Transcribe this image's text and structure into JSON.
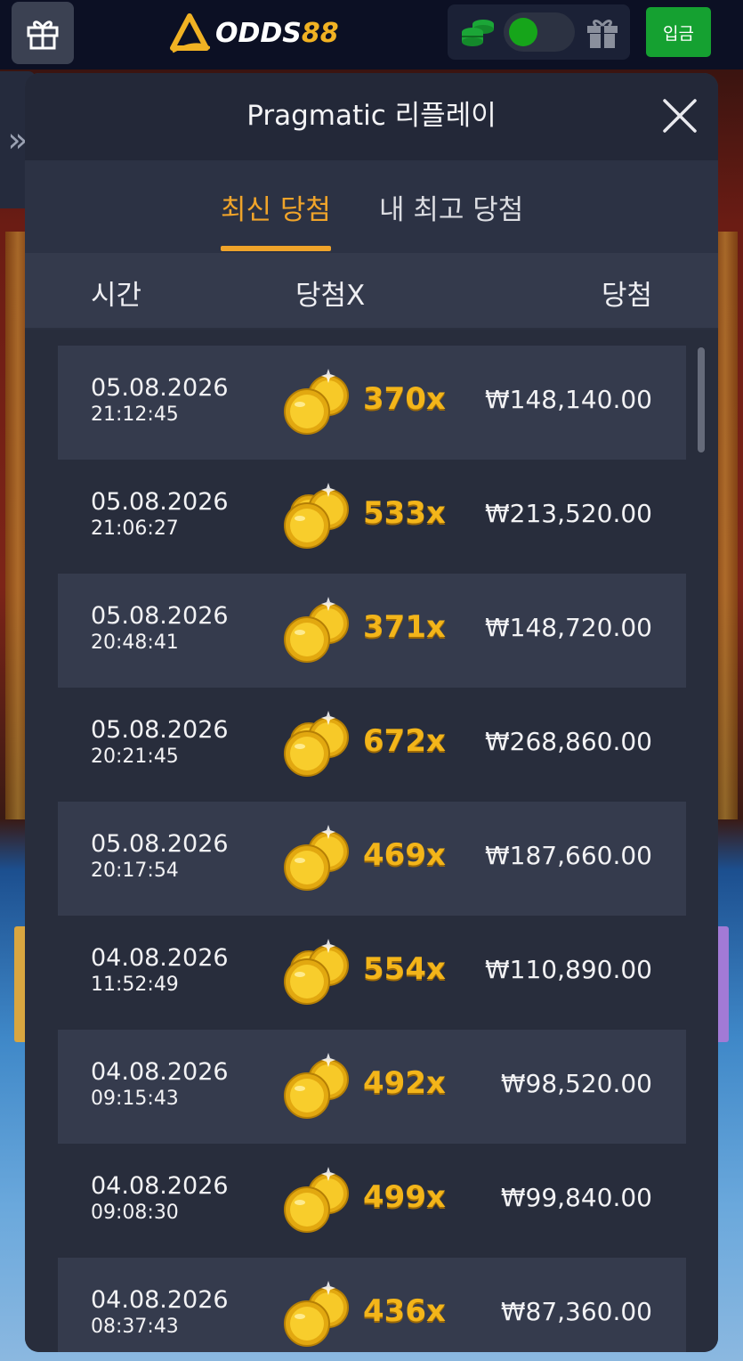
{
  "topbar": {
    "brand": "ODDS",
    "brand_number": "88",
    "deposit_label": "입금",
    "toggle_on": true
  },
  "side_tab": {
    "glyph": "»"
  },
  "modal": {
    "title": "Pragmatic 리플레이",
    "tabs": [
      {
        "label": "최신 당첨",
        "active": true
      },
      {
        "label": "내 최고 당첨",
        "active": false
      }
    ],
    "columns": {
      "time": "시간",
      "multiplier": "당첨X",
      "win": "당첨"
    },
    "rows": [
      {
        "date": "05.08.2026",
        "time": "21:12:45",
        "multiplier": "370x",
        "win": "₩148,140.00"
      },
      {
        "date": "05.08.2026",
        "time": "21:06:27",
        "multiplier": "533x",
        "win": "₩213,520.00"
      },
      {
        "date": "05.08.2026",
        "time": "20:48:41",
        "multiplier": "371x",
        "win": "₩148,720.00"
      },
      {
        "date": "05.08.2026",
        "time": "20:21:45",
        "multiplier": "672x",
        "win": "₩268,860.00"
      },
      {
        "date": "05.08.2026",
        "time": "20:17:54",
        "multiplier": "469x",
        "win": "₩187,660.00"
      },
      {
        "date": "04.08.2026",
        "time": "11:52:49",
        "multiplier": "554x",
        "win": "₩110,890.00"
      },
      {
        "date": "04.08.2026",
        "time": "09:15:43",
        "multiplier": "492x",
        "win": "₩98,520.00"
      },
      {
        "date": "04.08.2026",
        "time": "09:08:30",
        "multiplier": "499x",
        "win": "₩99,840.00"
      },
      {
        "date": "04.08.2026",
        "time": "08:37:43",
        "multiplier": "436x",
        "win": "₩87,360.00"
      }
    ]
  },
  "colors": {
    "accent": "#f0a42a",
    "multiplier": "#f3b51a",
    "deposit": "#15a131",
    "modal_bg": "#343a4c",
    "row_alt": "#282d3c"
  },
  "icons": {
    "gift_button": "gift-icon",
    "wallet_coins": "coins-stack-icon",
    "wallet_gift": "gift-icon",
    "close": "close-icon",
    "row_coins": "gold-coins-icon"
  }
}
